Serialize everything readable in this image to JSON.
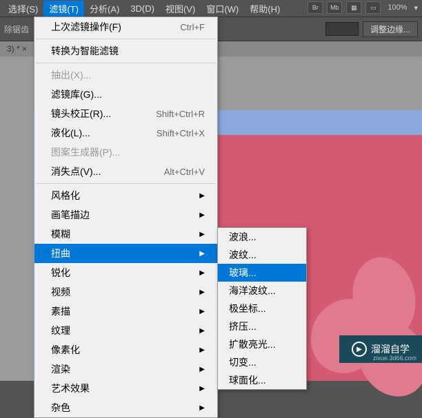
{
  "menubar": {
    "items": [
      {
        "label": "选择(S)"
      },
      {
        "label": "滤镜(T)"
      },
      {
        "label": "分析(A)"
      },
      {
        "label": "3D(D)"
      },
      {
        "label": "视图(V)"
      },
      {
        "label": "窗口(W)"
      },
      {
        "label": "帮助(H)"
      }
    ]
  },
  "topbar": {
    "icons": [
      "Br",
      "Mb"
    ],
    "zoom": "100%"
  },
  "toolbar": {
    "label1": "除锯齿",
    "btn1": "调整边缘..."
  },
  "tabs": {
    "item": "3) * ×"
  },
  "menu": {
    "last_filter": "上次滤镜操作(F)",
    "last_filter_sc": "Ctrl+F",
    "smart": "转换为智能滤镜",
    "extract": "抽出(X)...",
    "gallery": "滤镜库(G)...",
    "lens": "镜头校正(R)...",
    "lens_sc": "Shift+Ctrl+R",
    "liquify": "液化(L)...",
    "liquify_sc": "Shift+Ctrl+X",
    "pattern": "图案生成器(P)...",
    "vanish": "消失点(V)...",
    "vanish_sc": "Alt+Ctrl+V",
    "style": "风格化",
    "brush": "画笔描边",
    "blur": "模糊",
    "distort": "扭曲",
    "sharpen": "锐化",
    "video": "视频",
    "sketch": "素描",
    "texture": "纹理",
    "pixelate": "像素化",
    "render": "渲染",
    "artistic": "艺术效果",
    "other": "杂色"
  },
  "submenu": {
    "wave": "波浪...",
    "ripple": "波纹...",
    "glass": "玻璃...",
    "ocean": "海洋波纹...",
    "polar": "极坐标...",
    "pinch": "挤压...",
    "diffuse": "扩散亮光...",
    "shear": "切变...",
    "spherize": "球面化..."
  },
  "watermark": {
    "title": "溜溜自学",
    "url": "zixue.3d66.com"
  }
}
